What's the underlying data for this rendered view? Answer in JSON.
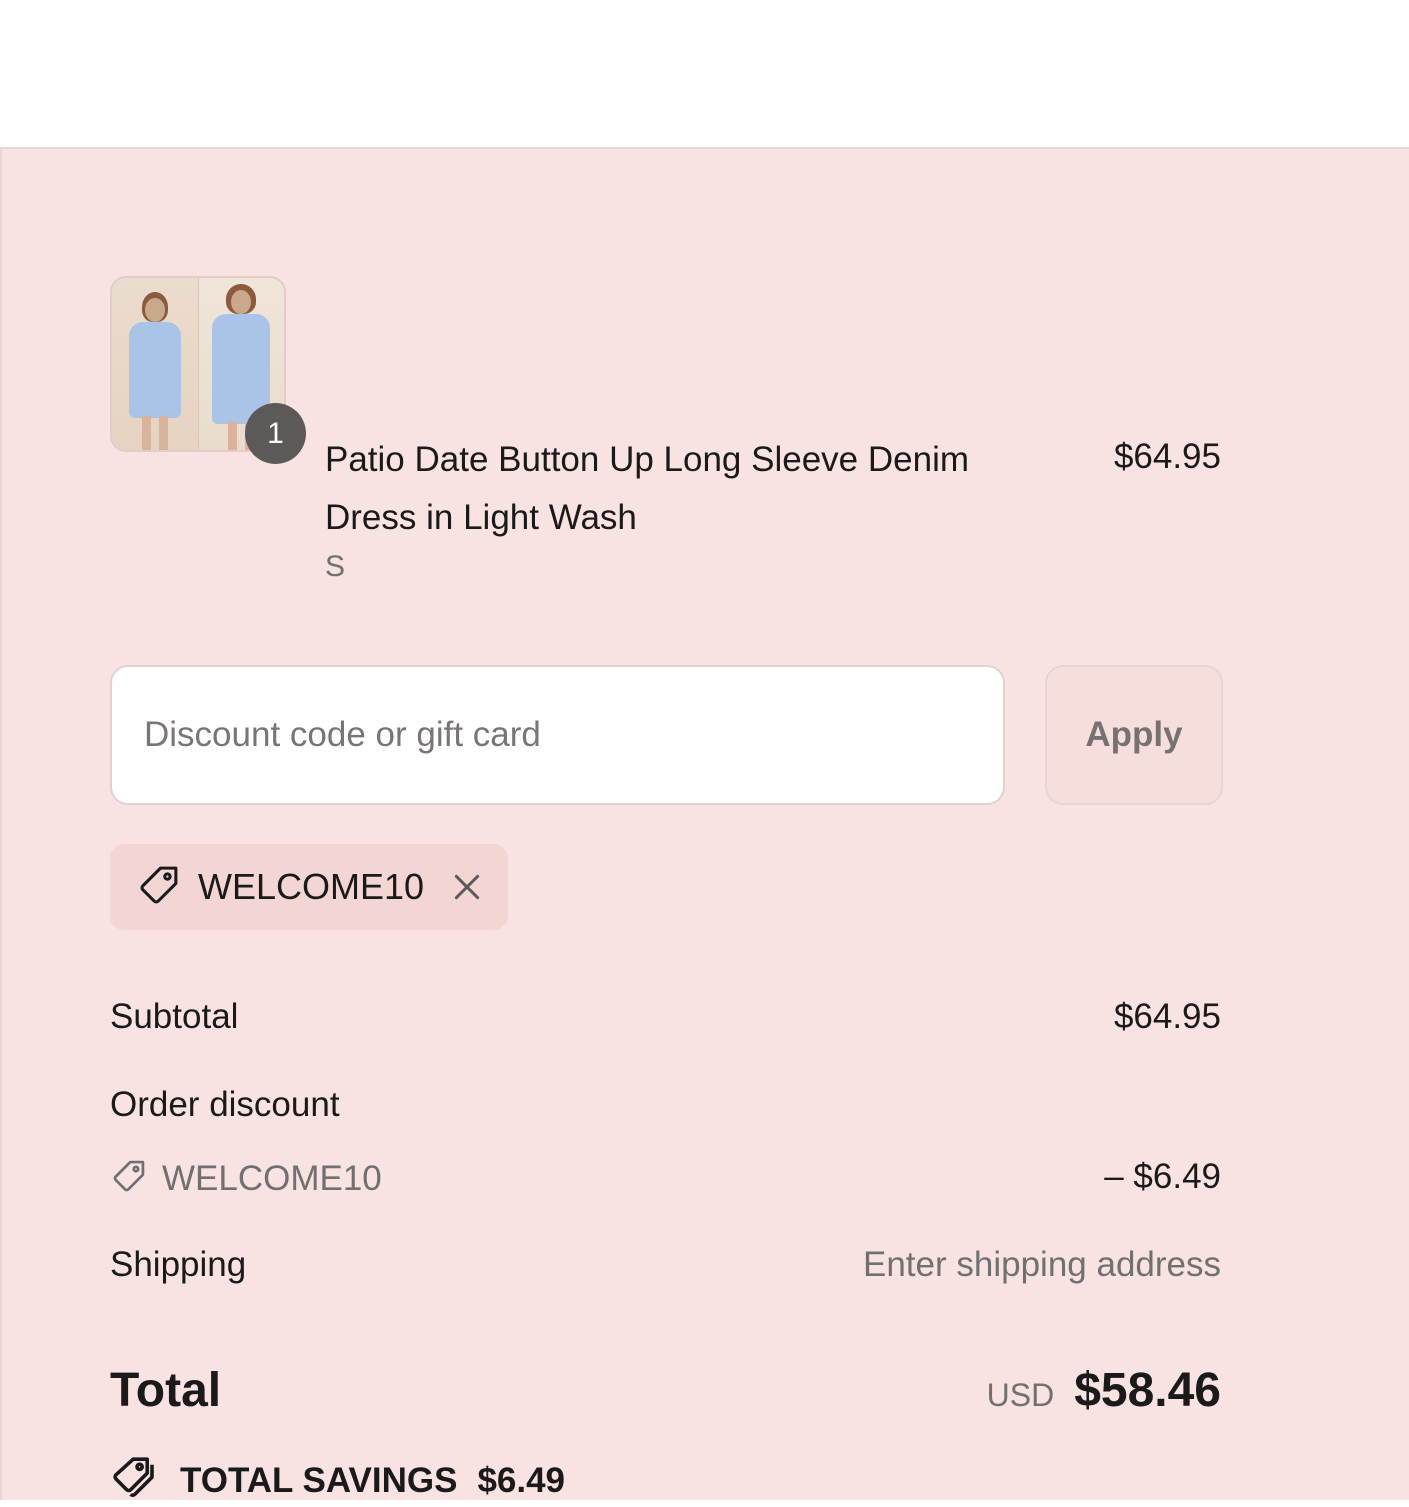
{
  "order_summary": {
    "background_color": "#f8e3e2",
    "product": {
      "title": "Patio Date Button Up Long Sleeve Denim Dress in Light Wash",
      "variant": "S",
      "price": "$64.95",
      "quantity": "1",
      "image_icon": "product-thumbnail-denim-dress"
    },
    "discount": {
      "placeholder": "Discount code or gift card",
      "value": "",
      "apply_label": "Apply",
      "applied_code": "WELCOME10",
      "tag_icon": "tag-icon",
      "remove_icon": "close-icon"
    },
    "totals": {
      "subtotal_label": "Subtotal",
      "subtotal_value": "$64.95",
      "order_discount_label": "Order discount",
      "order_discount_code": "WELCOME10",
      "order_discount_value": "– $6.49",
      "shipping_label": "Shipping",
      "shipping_value": "Enter shipping address",
      "total_label": "Total",
      "total_currency": "USD",
      "total_value": "$58.46",
      "savings_label": "TOTAL SAVINGS",
      "savings_value": "$6.49",
      "savings_icon": "tags-icon"
    }
  }
}
